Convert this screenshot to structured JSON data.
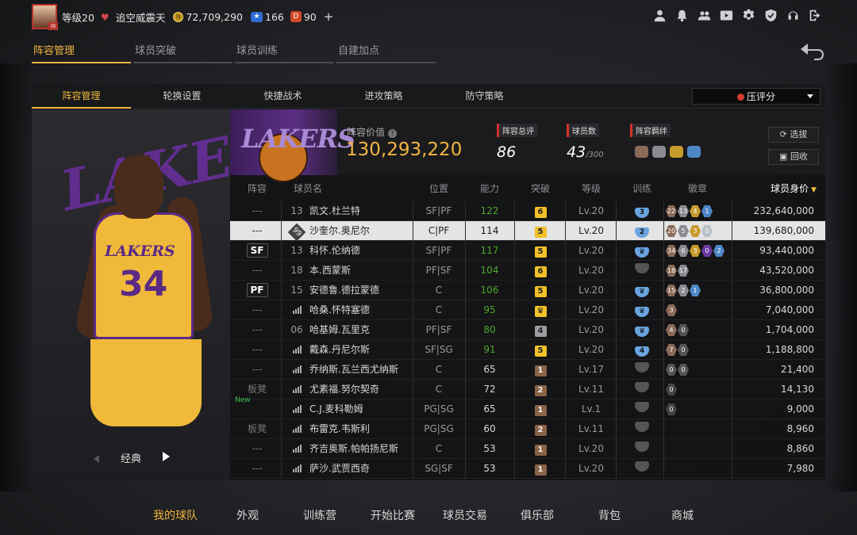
{
  "user": {
    "level": "等级20",
    "club": "追空威震天",
    "coins": "72,709,290",
    "stars": "166",
    "tickets": "90",
    "plus": "+"
  },
  "top_icons": [
    "profile-icon",
    "bell-icon",
    "friends-icon",
    "video-icon",
    "gear-icon",
    "shield-check-icon",
    "headset-icon",
    "logout-icon"
  ],
  "tabs": [
    "阵容管理",
    "球员突破",
    "球员训练",
    "自建加点"
  ],
  "subtabs": [
    "阵容管理",
    "轮换设置",
    "快捷战术",
    "进攻策略",
    "防守策略"
  ],
  "select": {
    "label": "压评分",
    "caret": "▼"
  },
  "team": {
    "logo": "LAKERS",
    "value_label": "阵容价值",
    "value": "130,293,220",
    "overall_label": "阵容总评",
    "overall": "86",
    "players_label": "球员数",
    "players": "43",
    "players_max": "/300",
    "bond_label": "阵容羁绊",
    "select_btn": "选拔",
    "recycle_btn": "回收"
  },
  "card": {
    "name": "经典",
    "number": "34",
    "logo": "LAKERS"
  },
  "columns": [
    "阵容",
    "球员名",
    "位置",
    "能力",
    "突破",
    "等级",
    "训练",
    "徽章",
    "球员身价"
  ],
  "rows": [
    {
      "role": "---",
      "num": "13",
      "name": "凯文.杜兰特",
      "pos": "SF|PF",
      "ability": "122",
      "green": true,
      "brk": "6",
      "bc": "y",
      "lv": "Lv.20",
      "train": "3",
      "tc": "b",
      "badges": [
        [
          "22",
          "#8a6a58"
        ],
        [
          "13",
          "#8a8b90"
        ],
        [
          "4",
          "#c79a2c"
        ],
        [
          "1",
          "#4f86c8"
        ]
      ],
      "price": "232,640,000"
    },
    {
      "role": "---",
      "num": "99",
      "name": "沙奎尔.奥尼尔",
      "pos": "C|PF",
      "ability": "114",
      "green": false,
      "brk": "5",
      "bc": "y",
      "lv": "Lv.20",
      "train": "2",
      "tc": "b",
      "badges": [
        [
          "20",
          "#8a6a58"
        ],
        [
          "5",
          "#8a8b90"
        ],
        [
          "3",
          "#c79a2c"
        ],
        [
          "0",
          "#b8c0c8"
        ]
      ],
      "price": "139,680,000",
      "selected": true
    },
    {
      "role": "SF",
      "num": "13",
      "name": "科怀.伦纳德",
      "pos": "SF|PF",
      "ability": "117",
      "green": true,
      "brk": "5",
      "bc": "y",
      "lv": "Lv.20",
      "train": "♛",
      "tc": "b",
      "badges": [
        [
          "34",
          "#8a6a58"
        ],
        [
          "6",
          "#8a8b90"
        ],
        [
          "3",
          "#c79a2c"
        ],
        [
          "0",
          "#6b3aa0"
        ],
        [
          "2",
          "#4f86c8"
        ]
      ],
      "price": "93,440,000"
    },
    {
      "role": "---",
      "num": "18",
      "name": "本.西蒙斯",
      "pos": "PF|SF",
      "ability": "104",
      "green": true,
      "brk": "6",
      "bc": "y",
      "lv": "Lv.20",
      "train": "",
      "tc": "d",
      "badges": [
        [
          "18",
          "#8a6a58"
        ],
        [
          "17",
          "#8a8b90"
        ]
      ],
      "price": "43,520,000"
    },
    {
      "role": "PF",
      "num": "15",
      "name": "安德鲁.德拉蒙德",
      "pos": "C",
      "ability": "106",
      "green": true,
      "brk": "5",
      "bc": "y",
      "lv": "Lv.20",
      "train": "♛",
      "tc": "b",
      "badges": [
        [
          "15",
          "#8a6a58"
        ],
        [
          "2",
          "#8a8b90"
        ],
        [
          "1",
          "#4f86c8"
        ]
      ],
      "price": "36,800,000"
    },
    {
      "role": "---",
      "num": "",
      "name": "哈桑.怀特塞德",
      "pos": "C",
      "ability": "95",
      "green": true,
      "brk": "♛",
      "bc": "y",
      "lv": "Lv.20",
      "train": "♛",
      "tc": "b",
      "badges": [
        [
          "3",
          "#8a6a58"
        ]
      ],
      "price": "7,040,000"
    },
    {
      "role": "---",
      "num": "06",
      "name": "哈基姆.瓦里克",
      "pos": "PF|SF",
      "ability": "80",
      "green": true,
      "brk": "4",
      "bc": "g",
      "lv": "Lv.20",
      "train": "♛",
      "tc": "b",
      "badges": [
        [
          "4",
          "#8a6a58"
        ],
        [
          "0",
          "#555"
        ]
      ],
      "price": "1,704,000"
    },
    {
      "role": "---",
      "num": "",
      "name": "戴森.丹尼尔斯",
      "pos": "SF|SG",
      "ability": "91",
      "green": true,
      "brk": "5",
      "bc": "y",
      "lv": "Lv.20",
      "train": "4",
      "tc": "b",
      "badges": [
        [
          "7",
          "#8a6a58"
        ],
        [
          "0",
          "#555"
        ]
      ],
      "price": "1,188,800"
    },
    {
      "role": "---",
      "num": "",
      "name": "乔纳斯.瓦兰西尤纳斯",
      "pos": "C",
      "ability": "65",
      "green": false,
      "brk": "1",
      "bc": "b",
      "lv": "Lv.17",
      "train": "",
      "tc": "d",
      "badges": [
        [
          "0",
          "#555"
        ],
        [
          "0",
          "#555"
        ]
      ],
      "price": "21,400"
    },
    {
      "role": "板凳",
      "num": "",
      "name": "尤素福.努尔契奇",
      "pos": "C",
      "ability": "72",
      "green": false,
      "brk": "2",
      "bc": "b",
      "lv": "Lv.11",
      "train": "",
      "tc": "d",
      "badges": [
        [
          "0",
          "#444"
        ]
      ],
      "price": "14,130"
    },
    {
      "role": "",
      "new": "New",
      "num": "",
      "name": "C.J.麦科勒姆",
      "pos": "PG|SG",
      "ability": "65",
      "green": false,
      "brk": "1",
      "bc": "b",
      "lv": "Lv.1",
      "train": "",
      "tc": "d",
      "badges": [
        [
          "0",
          "#444"
        ]
      ],
      "price": "9,000"
    },
    {
      "role": "板凳",
      "num": "",
      "name": "布雷克.韦斯利",
      "pos": "PG|SG",
      "ability": "60",
      "green": false,
      "brk": "2",
      "bc": "b",
      "lv": "Lv.11",
      "train": "",
      "tc": "d",
      "badges": [],
      "price": "8,960"
    },
    {
      "role": "---",
      "num": "",
      "name": "齐吉奥斯.帕帕扬尼斯",
      "pos": "C",
      "ability": "53",
      "green": false,
      "brk": "1",
      "bc": "b",
      "lv": "Lv.20",
      "train": "",
      "tc": "d",
      "badges": [],
      "price": "8,860"
    },
    {
      "role": "---",
      "num": "",
      "name": "萨沙.武贾西奇",
      "pos": "SG|SF",
      "ability": "53",
      "green": false,
      "brk": "1",
      "bc": "b",
      "lv": "Lv.20",
      "train": "",
      "tc": "d",
      "badges": [],
      "price": "7,980"
    }
  ],
  "bottom_nav": [
    "我的球队",
    "外观",
    "训练营",
    "开始比赛",
    "球员交易",
    "俱乐部",
    "背包",
    "商城"
  ]
}
